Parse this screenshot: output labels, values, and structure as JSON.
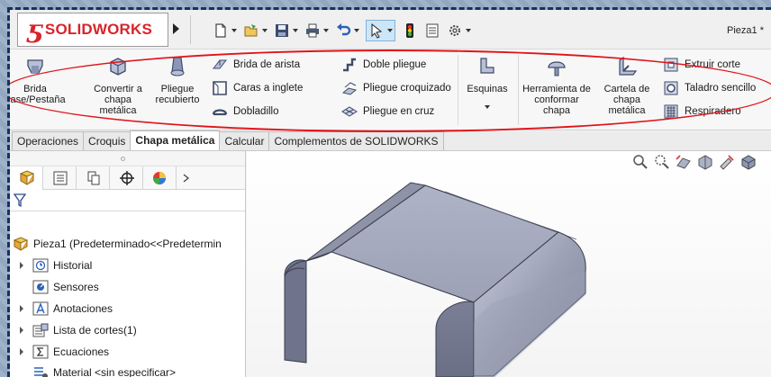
{
  "app": {
    "brand": "SOLIDWORKS",
    "document_title": "Pieza1 *",
    "colors": {
      "brand_red": "#d8242b",
      "highlight_oval": "#e0141b",
      "part_face": "#8a8fa8",
      "frame_dash": "#15325e"
    }
  },
  "quick_access": {
    "items": [
      {
        "name": "new-document-icon"
      },
      {
        "name": "open-folder-icon"
      },
      {
        "name": "save-icon"
      },
      {
        "name": "print-icon"
      },
      {
        "name": "undo-icon"
      },
      {
        "name": "select-pointer-icon"
      },
      {
        "name": "rebuild-traffic-light-icon"
      },
      {
        "name": "file-properties-icon"
      },
      {
        "name": "options-gear-icon"
      }
    ]
  },
  "ribbon": {
    "big": {
      "brida_base": "Brida base/Pestaña",
      "convertir": "Convertir a chapa metálica",
      "pliegue_recubierto": "Pliegue recubierto",
      "esquinas": "Esquinas",
      "herramienta": "Herramienta de conformar chapa",
      "cartela": "Cartela de chapa metálica"
    },
    "small": {
      "brida_arista": "Brida de arista",
      "caras_inglete": "Caras a inglete",
      "dobladillo": "Dobladillo",
      "doble_pliegue": "Doble pliegue",
      "pliegue_croquizado": "Pliegue croquizado",
      "pliegue_cruz": "Pliegue en cruz",
      "extruir_corte": "Extruir corte",
      "taladro_sencillo": "Taladro sencillo",
      "respiradero": "Respiradero"
    }
  },
  "tabs": [
    {
      "label": "Operaciones"
    },
    {
      "label": "Croquis"
    },
    {
      "label": "Chapa metálica",
      "active": true
    },
    {
      "label": "Calcular"
    },
    {
      "label": "Complementos de SOLIDWORKS"
    }
  ],
  "tree": {
    "root": "Pieza1  (Predeterminado<<Predetermin",
    "items": [
      {
        "label": "Historial",
        "icon": "history-icon",
        "expandable": true
      },
      {
        "label": "Sensores",
        "icon": "sensor-icon",
        "expandable": false
      },
      {
        "label": "Anotaciones",
        "icon": "annotations-icon",
        "expandable": true
      },
      {
        "label": "Lista de cortes(1)",
        "icon": "cut-list-icon",
        "expandable": true
      },
      {
        "label": "Ecuaciones",
        "icon": "equations-icon",
        "expandable": true
      },
      {
        "label": "Material <sin especificar>",
        "icon": "material-icon",
        "expandable": false
      }
    ]
  }
}
